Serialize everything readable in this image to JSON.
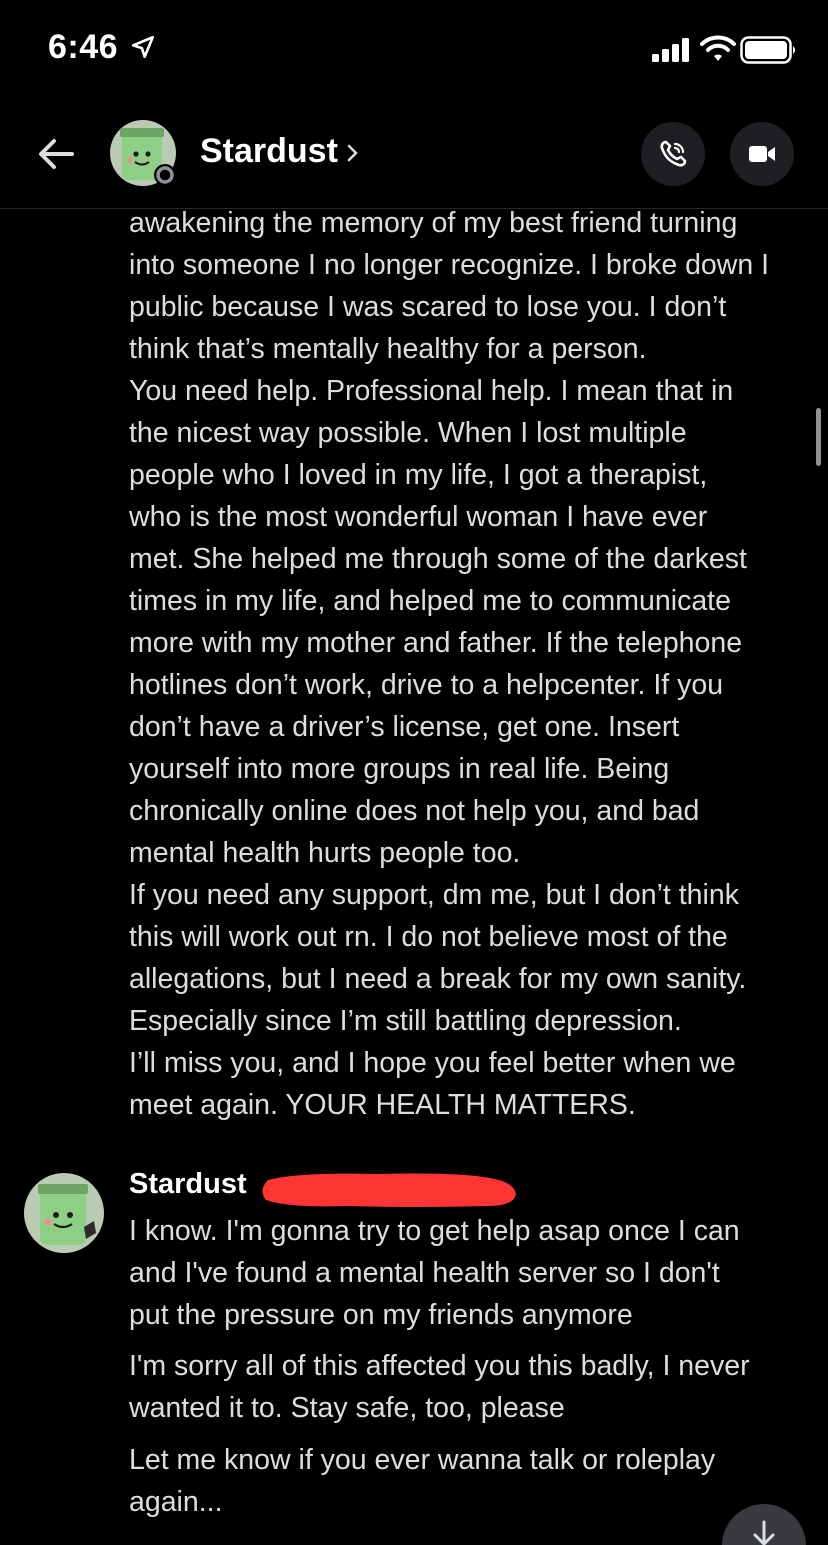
{
  "status_bar": {
    "time": "6:46",
    "icons": [
      "location-arrow-icon",
      "signal-icon",
      "wifi-icon",
      "battery-icon"
    ]
  },
  "header": {
    "back_icon": "arrow-left-icon",
    "channel_name": "Stardust",
    "chevron": "›",
    "call_icon": "phone-icon",
    "video_icon": "video-camera-icon"
  },
  "colors": {
    "background": "#000000",
    "text": "#dbdee1",
    "name": "#ffffff",
    "redaction": "#ff3434",
    "button_bg": "#1e1f22",
    "avatar_green": "#8ecf86"
  },
  "messages": {
    "previous": {
      "text": "awakening the memory of my best friend turning\ninto someone I no longer recognize. I broke down I\npublic because I was scared to lose you. I don’t\nthink that’s mentally healthy for a person.\nYou need help. Professional help. I mean that in\nthe nicest way possible. When I lost multiple\npeople who I loved in my life, I got a therapist,\nwho is the most wonderful woman I have ever\nmet. She helped me through some of the darkest\ntimes in my life, and helped me to communicate\nmore with my mother and father. If the telephone\nhotlines don’t work, drive to a helpcenter. If you\ndon’t have a driver’s license, get one. Insert\nyourself into more groups in real life. Being\nchronically online does not help you, and bad\nmental health hurts people too.\nIf you need any support, dm me, but I don’t think\nthis will work out rn. I do not believe most of the\nallegations, but I need a break for my own sanity.\nEspecially since I’m still battling depression.\nI’ll miss you, and I hope you feel better when we\nmeet again. YOUR HEALTH MATTERS."
    },
    "group": {
      "author": "Stardust",
      "items": [
        {
          "text": "I know. I'm gonna try to get help asap once I can\nand I've found a mental health server so I don't\nput the pressure on my friends anymore"
        },
        {
          "text": "I'm sorry all of this affected you this badly, I never\nwanted it to. Stay safe, too, please"
        },
        {
          "text": "Let me know if you ever wanna talk or roleplay\nagain..."
        }
      ]
    }
  },
  "jump_button_icon": "arrow-down-icon"
}
